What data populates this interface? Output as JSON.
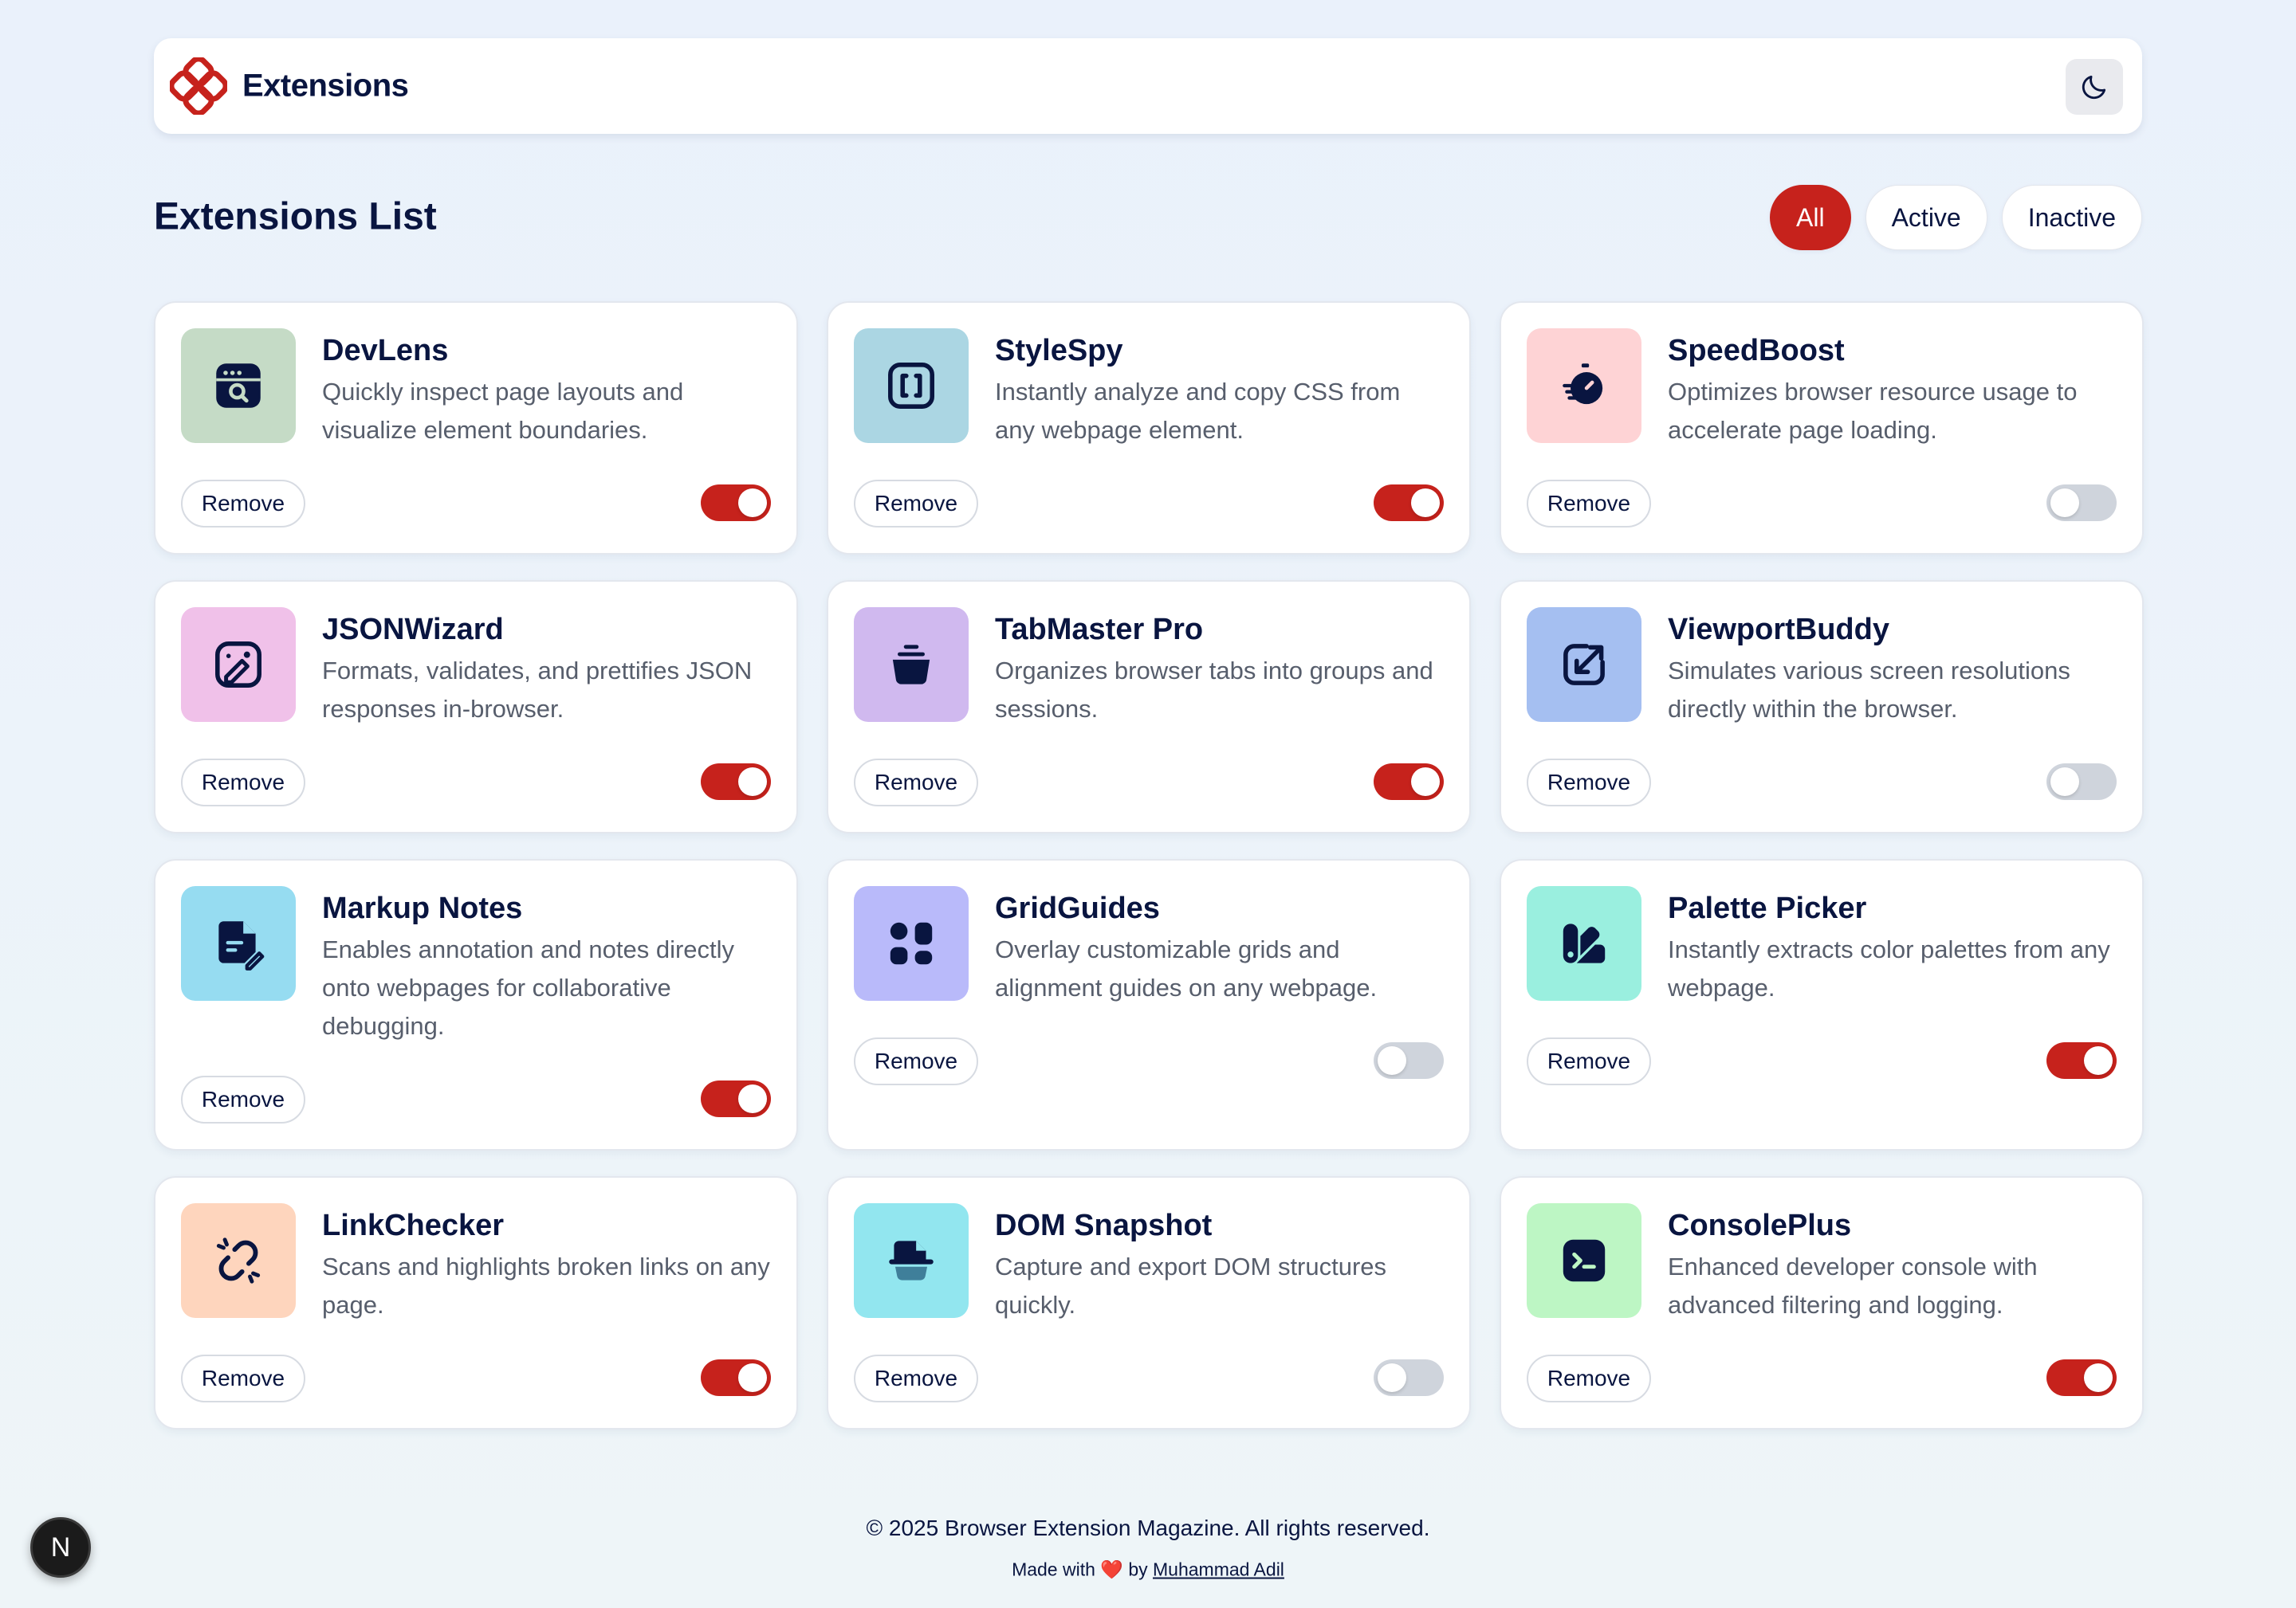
{
  "header": {
    "title": "Extensions",
    "logo_icon": "extensions-logo-icon",
    "theme_icon": "moon-icon",
    "brand_color": "#c6221c"
  },
  "list": {
    "title": "Extensions List",
    "filters": [
      {
        "label": "All",
        "selected": true
      },
      {
        "label": "Active",
        "selected": false
      },
      {
        "label": "Inactive",
        "selected": false
      }
    ]
  },
  "remove_label": "Remove",
  "extensions": [
    {
      "name": "DevLens",
      "description": "Quickly inspect page layouts and visualize element boundaries.",
      "active": true,
      "icon": "browser-search-icon",
      "icon_bg": "#c5dbc6"
    },
    {
      "name": "StyleSpy",
      "description": "Instantly analyze and copy CSS from any webpage element.",
      "active": true,
      "icon": "brackets-icon",
      "icon_bg": "#abd6e3"
    },
    {
      "name": "SpeedBoost",
      "description": "Optimizes browser resource usage to accelerate page loading.",
      "active": false,
      "icon": "stopwatch-icon",
      "icon_bg": "#fed3d5"
    },
    {
      "name": "JSONWizard",
      "description": "Formats, validates, and prettifies JSON responses in-browser.",
      "active": true,
      "icon": "image-edit-icon",
      "icon_bg": "#f0c1e9"
    },
    {
      "name": "TabMaster Pro",
      "description": "Organizes browser tabs into groups and sessions.",
      "active": true,
      "icon": "basket-icon",
      "icon_bg": "#d0b9ef"
    },
    {
      "name": "ViewportBuddy",
      "description": "Simulates various screen resolutions directly within the browser.",
      "active": false,
      "icon": "resize-icon",
      "icon_bg": "#a5bff1"
    },
    {
      "name": "Markup Notes",
      "description": "Enables annotation and notes directly onto webpages for collaborative debugging.",
      "active": true,
      "icon": "note-edit-icon",
      "icon_bg": "#96dcf1"
    },
    {
      "name": "GridGuides",
      "description": "Overlay customizable grids and alignment guides on any webpage.",
      "active": false,
      "icon": "grid-icon",
      "icon_bg": "#b9bafa"
    },
    {
      "name": "Palette Picker",
      "description": "Instantly extracts color palettes from any webpage.",
      "active": true,
      "icon": "palette-icon",
      "icon_bg": "#9aefdf"
    },
    {
      "name": "LinkChecker",
      "description": "Scans and highlights broken links on any page.",
      "active": true,
      "icon": "broken-link-icon",
      "icon_bg": "#fed5bd"
    },
    {
      "name": "DOM Snapshot",
      "description": "Capture and export DOM structures quickly.",
      "active": false,
      "icon": "snapshot-icon",
      "icon_bg": "#92e6ef"
    },
    {
      "name": "ConsolePlus",
      "description": "Enhanced developer console with advanced filtering and logging.",
      "active": true,
      "icon": "terminal-icon",
      "icon_bg": "#bdf6c4"
    }
  ],
  "footer": {
    "copyright": "© 2025 Browser Extension Magazine. All rights reserved.",
    "made_with": "Made with",
    "heart": "❤️",
    "by": "by",
    "author": "Muhammad Adil"
  },
  "dev_badge": "N"
}
